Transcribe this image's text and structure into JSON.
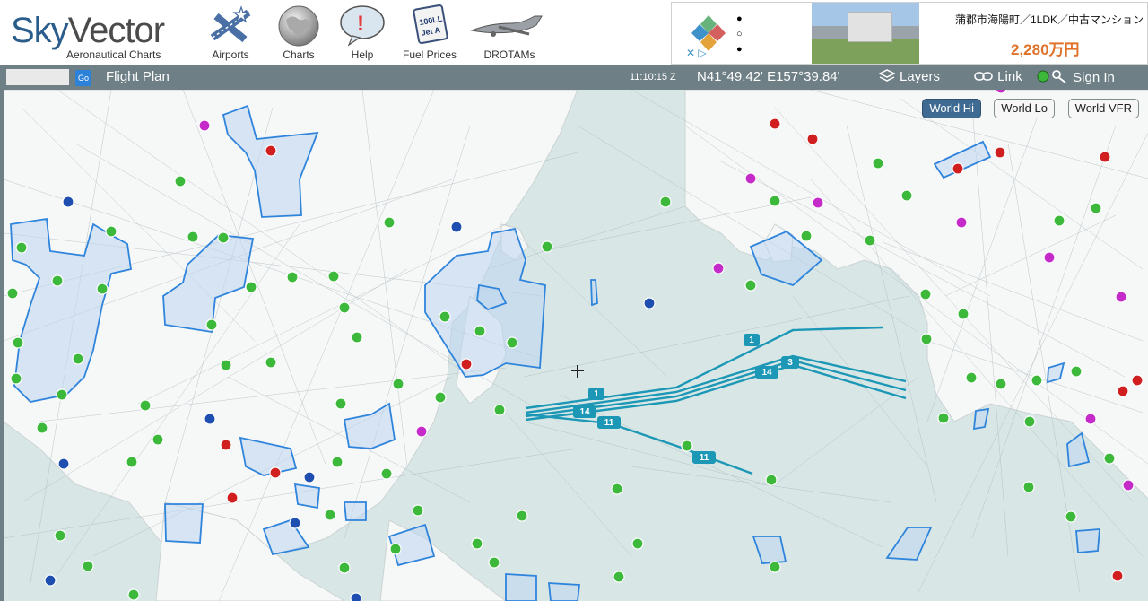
{
  "brand": {
    "name_a": "Sky",
    "name_b": "Vector",
    "sub": "Aeronautical Charts"
  },
  "nav": [
    {
      "label": "Airports",
      "icon": "airport-icon"
    },
    {
      "label": "Charts",
      "icon": "globe-icon"
    },
    {
      "label": "Help",
      "icon": "help-icon"
    },
    {
      "label": "Fuel Prices",
      "icon": "fuel-sign-icon",
      "sign": [
        "100LL",
        "Jet A"
      ]
    },
    {
      "label": "DROTAMs",
      "icon": "drone-icon"
    }
  ],
  "ad": {
    "title": "蒲郡市海陽町／1LDK／中古マンション",
    "price": "2,280万円",
    "dots": [
      "●",
      "○",
      "●"
    ]
  },
  "toolbar": {
    "go": "Go",
    "flight_plan": "Flight Plan",
    "clock": "11:10:15 Z",
    "coords": "N41°49.42' E157°39.84'",
    "layers": "Layers",
    "link": "Link",
    "signin": "Sign In"
  },
  "chart_buttons": [
    {
      "label": "World Hi",
      "active": true
    },
    {
      "label": "World Lo",
      "active": false
    },
    {
      "label": "World VFR",
      "active": false
    }
  ],
  "tracks": [
    "1",
    "14",
    "3",
    "11"
  ],
  "colors": {
    "brand_blue": "#2a5d8c",
    "toolbar": "#6e7f86",
    "ocean": "#d8e7e6",
    "land": "#f7f8f8",
    "airspace": "#2f84dc",
    "track": "#1c97b6",
    "airport_green": "#3cb83a",
    "airport_red": "#d11f1f",
    "airport_magenta": "#c42bc9",
    "airport_blue": "#1e4fb0"
  }
}
